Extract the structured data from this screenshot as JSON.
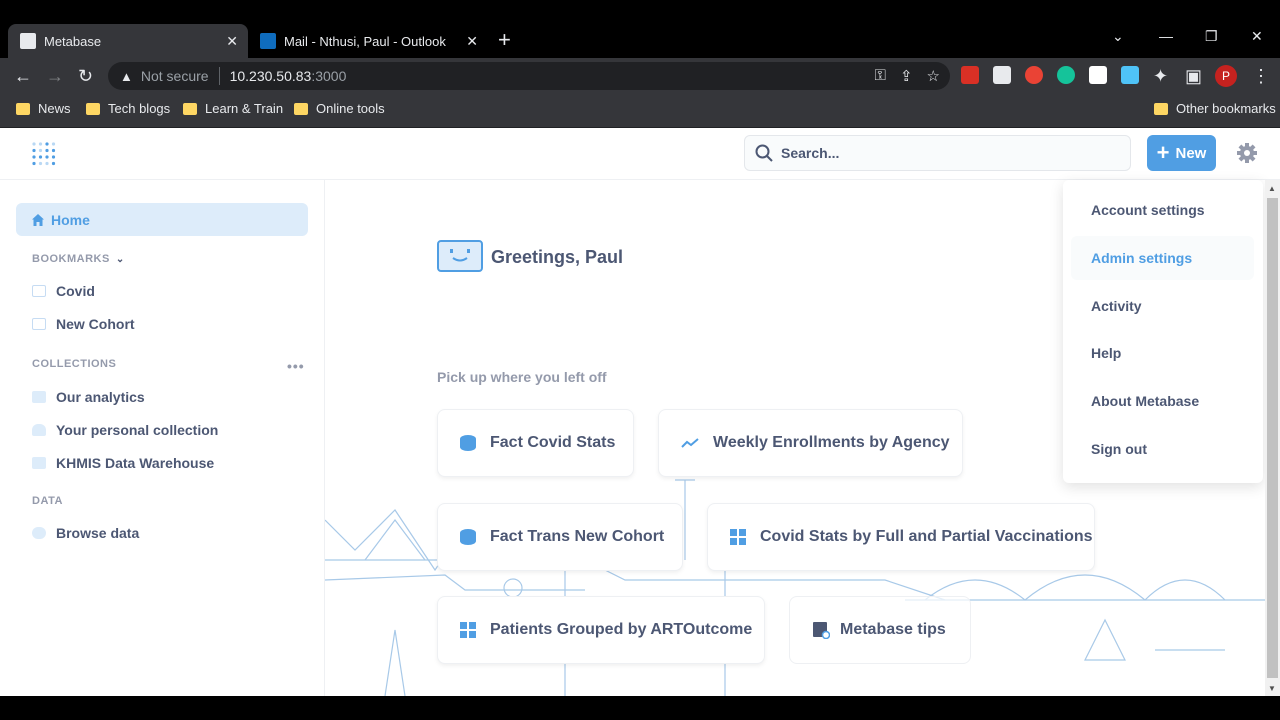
{
  "browser": {
    "tabs": [
      {
        "title": "Metabase",
        "active": true
      },
      {
        "title": "Mail - Nthusi, Paul - Outlook",
        "active": false
      }
    ],
    "security_label": "Not secure",
    "url_host": "10.230.50.83",
    "url_port": ":3000",
    "profile_initial": "P",
    "bookmarks": [
      "News",
      "Tech blogs",
      "Learn & Train",
      "Online tools"
    ],
    "other_bookmarks": "Other bookmarks"
  },
  "topnav": {
    "search_label": "Search...",
    "new_label": "New"
  },
  "sidebar": {
    "home": "Home",
    "bookmarks_header": "BOOKMARKS",
    "bookmarks": [
      "Covid",
      "New Cohort"
    ],
    "collections_header": "COLLECTIONS",
    "collections": [
      "Our analytics",
      "Your personal collection",
      "KHMIS Data Warehouse"
    ],
    "data_header": "DATA",
    "browse_data": "Browse data"
  },
  "main": {
    "greeting": "Greetings, Paul",
    "pickup": "Pick up where you left off",
    "cards": [
      {
        "title": "Fact Covid Stats",
        "icon": "database-icon"
      },
      {
        "title": "Weekly Enrollments by Agency",
        "icon": "line-chart-icon"
      },
      {
        "title": "Fact Trans New Cohort",
        "icon": "database-icon"
      },
      {
        "title": "Covid Stats by Full and Partial Vaccinations",
        "icon": "table-icon"
      },
      {
        "title": "Patients Grouped by ARTOutcome",
        "icon": "table-icon"
      },
      {
        "title": "Metabase tips",
        "icon": "book-icon"
      }
    ]
  },
  "settings_menu": {
    "items": [
      "Account settings",
      "Admin settings",
      "Activity",
      "Help",
      "About Metabase",
      "Sign out"
    ],
    "hovered": "Admin settings"
  },
  "colors": {
    "brand": "#509ee3",
    "text": "#4c5773",
    "muted": "#949aab"
  }
}
